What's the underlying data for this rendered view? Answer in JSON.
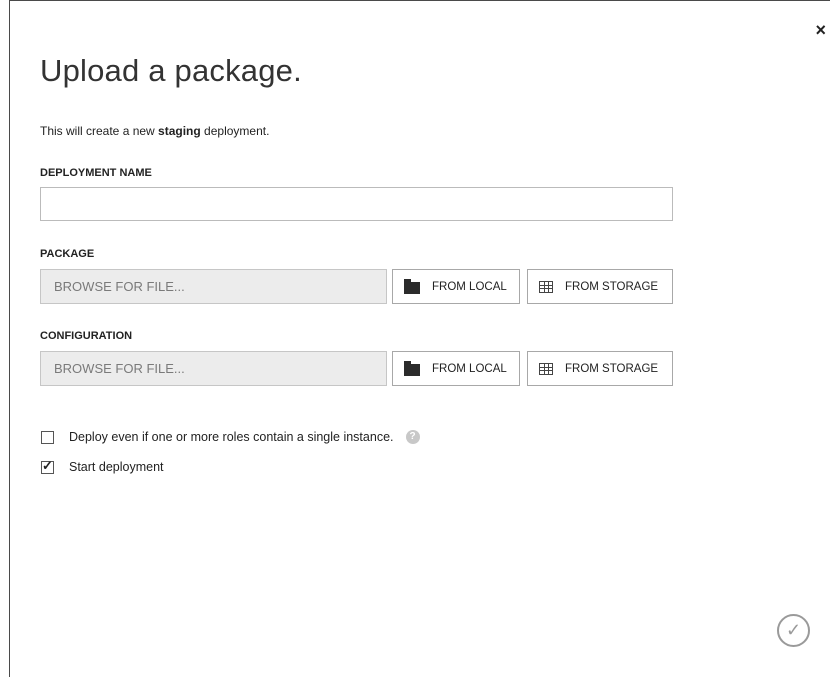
{
  "dialog": {
    "close_glyph": "×",
    "title": "Upload a package.",
    "subtitle_prefix": "This will create a new ",
    "subtitle_bold": "staging",
    "subtitle_suffix": " deployment."
  },
  "deployment_name": {
    "label": "DEPLOYMENT NAME",
    "value": ""
  },
  "package": {
    "label": "PACKAGE",
    "browse_text": "BROWSE FOR FILE...",
    "from_local": "FROM LOCAL",
    "from_storage": "FROM STORAGE"
  },
  "configuration": {
    "label": "CONFIGURATION",
    "browse_text": "BROWSE FOR FILE...",
    "from_local": "FROM LOCAL",
    "from_storage": "FROM STORAGE"
  },
  "options": {
    "deploy_single": {
      "label": "Deploy even if one or more roles contain a single instance.",
      "checked": false,
      "help_glyph": "?"
    },
    "start_deployment": {
      "label": "Start deployment",
      "checked": true
    }
  },
  "confirm_glyph": "✓",
  "icons": [
    "close-icon",
    "folder-icon",
    "storage-table-icon",
    "help-icon",
    "checkmark-icon"
  ]
}
